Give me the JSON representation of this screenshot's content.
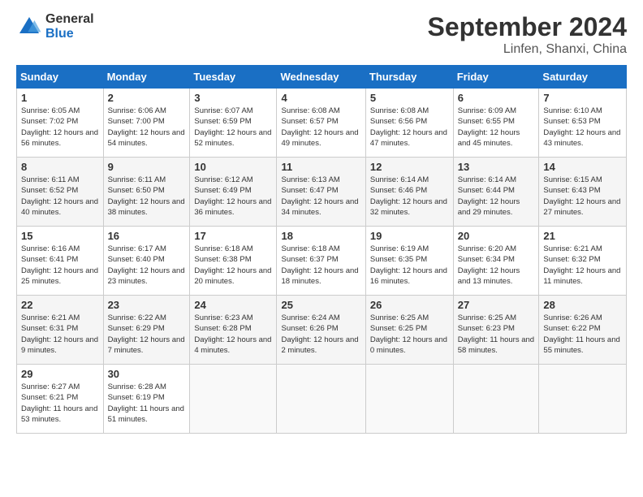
{
  "logo": {
    "general": "General",
    "blue": "Blue"
  },
  "header": {
    "title": "September 2024",
    "location": "Linfen, Shanxi, China"
  },
  "weekdays": [
    "Sunday",
    "Monday",
    "Tuesday",
    "Wednesday",
    "Thursday",
    "Friday",
    "Saturday"
  ],
  "weeks": [
    [
      {
        "day": "1",
        "sunrise": "6:05 AM",
        "sunset": "7:02 PM",
        "daylight": "12 hours and 56 minutes."
      },
      {
        "day": "2",
        "sunrise": "6:06 AM",
        "sunset": "7:00 PM",
        "daylight": "12 hours and 54 minutes."
      },
      {
        "day": "3",
        "sunrise": "6:07 AM",
        "sunset": "6:59 PM",
        "daylight": "12 hours and 52 minutes."
      },
      {
        "day": "4",
        "sunrise": "6:08 AM",
        "sunset": "6:57 PM",
        "daylight": "12 hours and 49 minutes."
      },
      {
        "day": "5",
        "sunrise": "6:08 AM",
        "sunset": "6:56 PM",
        "daylight": "12 hours and 47 minutes."
      },
      {
        "day": "6",
        "sunrise": "6:09 AM",
        "sunset": "6:55 PM",
        "daylight": "12 hours and 45 minutes."
      },
      {
        "day": "7",
        "sunrise": "6:10 AM",
        "sunset": "6:53 PM",
        "daylight": "12 hours and 43 minutes."
      }
    ],
    [
      {
        "day": "8",
        "sunrise": "6:11 AM",
        "sunset": "6:52 PM",
        "daylight": "12 hours and 40 minutes."
      },
      {
        "day": "9",
        "sunrise": "6:11 AM",
        "sunset": "6:50 PM",
        "daylight": "12 hours and 38 minutes."
      },
      {
        "day": "10",
        "sunrise": "6:12 AM",
        "sunset": "6:49 PM",
        "daylight": "12 hours and 36 minutes."
      },
      {
        "day": "11",
        "sunrise": "6:13 AM",
        "sunset": "6:47 PM",
        "daylight": "12 hours and 34 minutes."
      },
      {
        "day": "12",
        "sunrise": "6:14 AM",
        "sunset": "6:46 PM",
        "daylight": "12 hours and 32 minutes."
      },
      {
        "day": "13",
        "sunrise": "6:14 AM",
        "sunset": "6:44 PM",
        "daylight": "12 hours and 29 minutes."
      },
      {
        "day": "14",
        "sunrise": "6:15 AM",
        "sunset": "6:43 PM",
        "daylight": "12 hours and 27 minutes."
      }
    ],
    [
      {
        "day": "15",
        "sunrise": "6:16 AM",
        "sunset": "6:41 PM",
        "daylight": "12 hours and 25 minutes."
      },
      {
        "day": "16",
        "sunrise": "6:17 AM",
        "sunset": "6:40 PM",
        "daylight": "12 hours and 23 minutes."
      },
      {
        "day": "17",
        "sunrise": "6:18 AM",
        "sunset": "6:38 PM",
        "daylight": "12 hours and 20 minutes."
      },
      {
        "day": "18",
        "sunrise": "6:18 AM",
        "sunset": "6:37 PM",
        "daylight": "12 hours and 18 minutes."
      },
      {
        "day": "19",
        "sunrise": "6:19 AM",
        "sunset": "6:35 PM",
        "daylight": "12 hours and 16 minutes."
      },
      {
        "day": "20",
        "sunrise": "6:20 AM",
        "sunset": "6:34 PM",
        "daylight": "12 hours and 13 minutes."
      },
      {
        "day": "21",
        "sunrise": "6:21 AM",
        "sunset": "6:32 PM",
        "daylight": "12 hours and 11 minutes."
      }
    ],
    [
      {
        "day": "22",
        "sunrise": "6:21 AM",
        "sunset": "6:31 PM",
        "daylight": "12 hours and 9 minutes."
      },
      {
        "day": "23",
        "sunrise": "6:22 AM",
        "sunset": "6:29 PM",
        "daylight": "12 hours and 7 minutes."
      },
      {
        "day": "24",
        "sunrise": "6:23 AM",
        "sunset": "6:28 PM",
        "daylight": "12 hours and 4 minutes."
      },
      {
        "day": "25",
        "sunrise": "6:24 AM",
        "sunset": "6:26 PM",
        "daylight": "12 hours and 2 minutes."
      },
      {
        "day": "26",
        "sunrise": "6:25 AM",
        "sunset": "6:25 PM",
        "daylight": "12 hours and 0 minutes."
      },
      {
        "day": "27",
        "sunrise": "6:25 AM",
        "sunset": "6:23 PM",
        "daylight": "11 hours and 58 minutes."
      },
      {
        "day": "28",
        "sunrise": "6:26 AM",
        "sunset": "6:22 PM",
        "daylight": "11 hours and 55 minutes."
      }
    ],
    [
      {
        "day": "29",
        "sunrise": "6:27 AM",
        "sunset": "6:21 PM",
        "daylight": "11 hours and 53 minutes."
      },
      {
        "day": "30",
        "sunrise": "6:28 AM",
        "sunset": "6:19 PM",
        "daylight": "11 hours and 51 minutes."
      },
      null,
      null,
      null,
      null,
      null
    ]
  ]
}
